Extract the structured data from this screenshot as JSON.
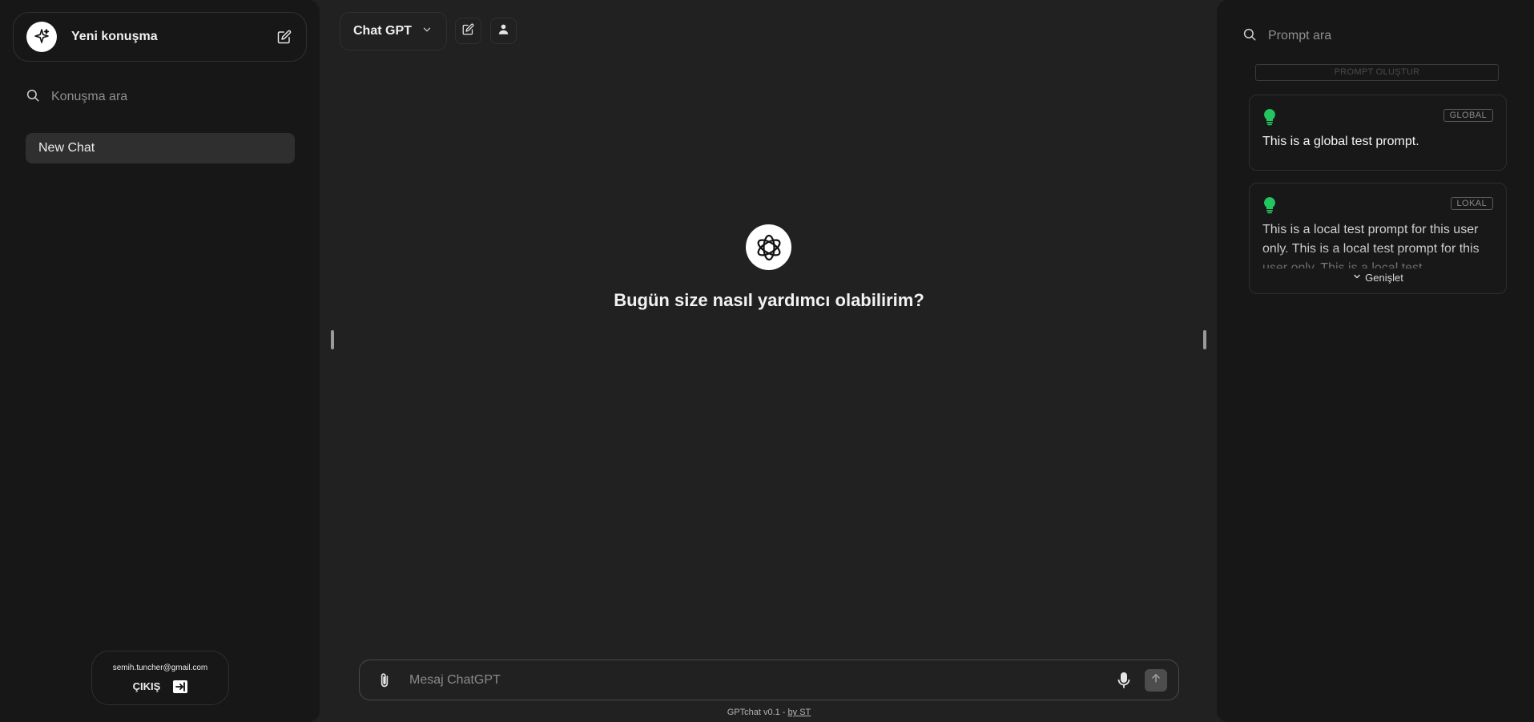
{
  "left_sidebar": {
    "new_conversation_label": "Yeni konuşma",
    "search_placeholder": "Konuşma ara",
    "chats": [
      {
        "label": "New Chat"
      }
    ],
    "user_email": "semih.tuncher@gmail.com",
    "logout_label": "ÇIKIŞ"
  },
  "header": {
    "model_name": "Chat GPT"
  },
  "main": {
    "greeting": "Bugün size nasıl yardımcı olabilirim?",
    "composer_placeholder": "Mesaj ChatGPT"
  },
  "footer": {
    "version_text": "GPTchat v0.1 - ",
    "author_link": "by ST"
  },
  "right_sidebar": {
    "search_placeholder": "Prompt ara",
    "create_prompt_label": "PROMPT OLUŞTUR",
    "prompts": [
      {
        "tag": "GLOBAL",
        "text": "This is a global test prompt."
      },
      {
        "tag": "LOKAL",
        "text": "This is a local test prompt for this user only. This is a local test prompt for this user only. This is a local test"
      }
    ],
    "expand_label": "Genişlet"
  },
  "colors": {
    "background": "#212121",
    "sidebar": "#171717",
    "bulb": "#22c55e",
    "accent_text": "#ececec"
  },
  "icons": [
    "sparkle-icon",
    "edit-icon",
    "search-icon",
    "chevron-down-icon",
    "user-icon",
    "openai-logo-icon",
    "paperclip-icon",
    "microphone-icon",
    "arrow-up-icon",
    "lightbulb-icon",
    "logout-icon"
  ]
}
